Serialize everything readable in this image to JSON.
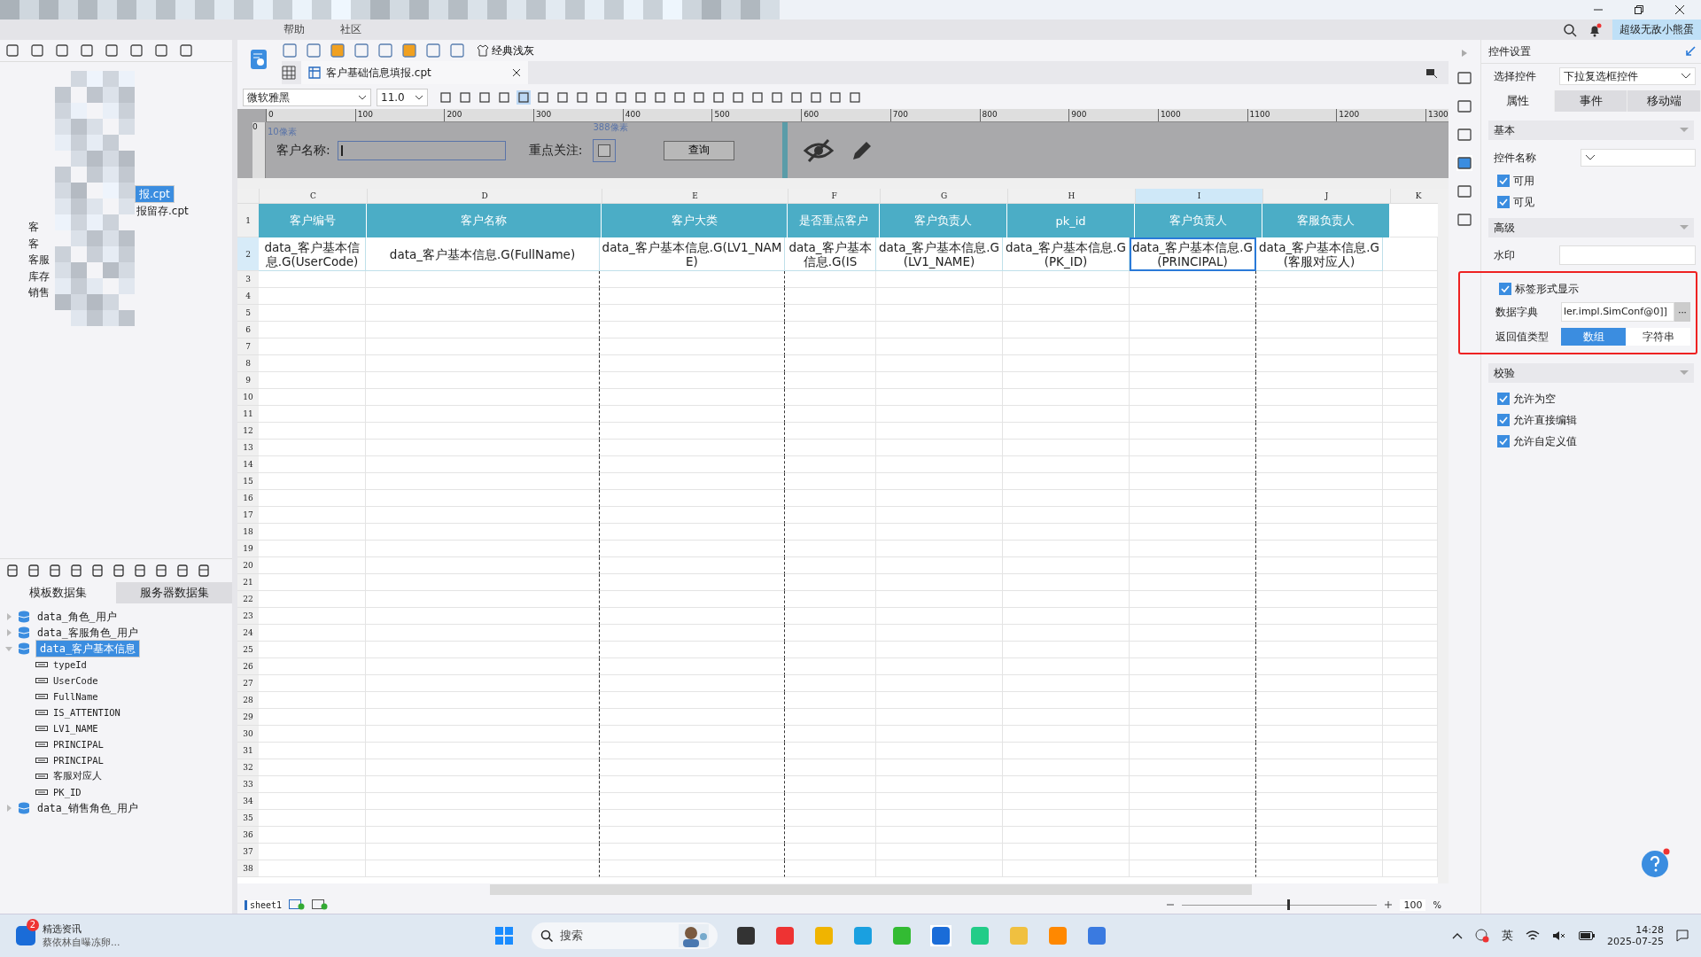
{
  "menu": [
    {
      "label": "帮助"
    },
    {
      "label": "社区"
    }
  ],
  "user": "超级无敌小熊蛋",
  "file_tree": [
    {
      "label": "报.cpt",
      "selected": true
    },
    {
      "label": "报留存.cpt",
      "selected": false
    },
    {
      "label": "客",
      "selected": false
    },
    {
      "label": "客",
      "selected": false
    },
    {
      "label": "客服",
      "selected": false
    },
    {
      "label": "库存",
      "selected": false
    },
    {
      "label": "销售",
      "selected": false
    }
  ],
  "dataset_tabs": [
    {
      "label": "模板数据集",
      "selected": true
    },
    {
      "label": "服务器数据集",
      "selected": false
    }
  ],
  "datasets": [
    {
      "label": "data_角色_用户",
      "expanded": false,
      "selected": false
    },
    {
      "label": "data_客服角色_用户",
      "expanded": false,
      "selected": false
    },
    {
      "label": "data_客户基本信息",
      "expanded": true,
      "selected": true,
      "children": [
        "typeId",
        "UserCode",
        "FullName",
        "IS_ATTENTION",
        "LV1_NAME",
        "PRINCIPAL",
        "PRINCIPAL",
        "客服对应人",
        "PK_ID"
      ]
    },
    {
      "label": "data_销售角色_用户",
      "expanded": false,
      "selected": false
    }
  ],
  "toolbar": {
    "theme_button": "经典浅灰",
    "file_tab": "客户基础信息填报.cpt",
    "font": "微软雅黑",
    "font_size": "11.0"
  },
  "ruler": [
    "0",
    "100",
    "200",
    "300",
    "400",
    "500",
    "600",
    "700",
    "800",
    "900",
    "1000",
    "1100",
    "1200",
    "1300"
  ],
  "vertical_ruler": "0",
  "parameter_panel": {
    "focus_checked": false,
    "name_label": "客户名称:",
    "focus_label": "重点关注:",
    "query_button": "查询",
    "marker_left": "10像素",
    "marker_right": "388像素"
  },
  "grid": {
    "columns": [
      {
        "letter": "C",
        "selected": false
      },
      {
        "letter": "D",
        "selected": false
      },
      {
        "letter": "E",
        "selected": false
      },
      {
        "letter": "F",
        "selected": false
      },
      {
        "letter": "G",
        "selected": false
      },
      {
        "letter": "H",
        "selected": false
      },
      {
        "letter": "I",
        "selected": true
      },
      {
        "letter": "J",
        "selected": false
      },
      {
        "letter": "K",
        "selected": false
      }
    ],
    "header_row": {
      "number": "1",
      "cells": [
        "客户编号",
        "客户名称",
        "客户大类",
        "是否重点客户",
        "客户负责人",
        "pk_id",
        "客户负责人",
        "客服负责人"
      ]
    },
    "data_row": {
      "number": "2",
      "cells": [
        {
          "text": "data_客户基本信息.G(UserCode)",
          "selected": false
        },
        {
          "text": "data_客户基本信息.G(FullName)",
          "selected": false
        },
        {
          "text": "data_客户基本信息.G(LV1_NAME)",
          "selected": false
        },
        {
          "text": "data_客户基本信息.G(IS",
          "selected": false
        },
        {
          "text": "data_客户基本信息.G(LV1_NAME)",
          "selected": false
        },
        {
          "text": "data_客户基本信息.G(PK_ID)",
          "selected": false
        },
        {
          "text": "data_客户基本信息.G(PRINCIPAL)",
          "selected": true
        },
        {
          "text": "data_客户基本信息.G(客服对应人)",
          "selected": false
        }
      ]
    },
    "empty_rows": [
      "3",
      "4",
      "5",
      "6",
      "7",
      "8",
      "9",
      "10",
      "11",
      "12",
      "13",
      "14",
      "15",
      "16",
      "17",
      "18",
      "19",
      "20",
      "21",
      "22",
      "23",
      "24",
      "25",
      "26",
      "27",
      "28",
      "29",
      "30",
      "31",
      "32",
      "33",
      "34",
      "35",
      "36",
      "37",
      "38"
    ]
  },
  "sheet_bar": {
    "sheet_tab": "sheet1",
    "zoom_slider": {
      "level": 0.54
    },
    "zoom": "100",
    "zoom_unit": "%"
  },
  "widget_settings": {
    "title": "控件设置",
    "select_label": "选择控件",
    "select_value": "下拉复选框控件",
    "tabs": [
      {
        "label": "属性",
        "selected": true
      },
      {
        "label": "事件",
        "selected": false
      },
      {
        "label": "移动端",
        "selected": false
      }
    ],
    "basic_section": "基本",
    "name_label": "控件名称",
    "basic_checks": [
      {
        "label": "可用",
        "checked": true
      },
      {
        "label": "可见",
        "checked": true
      }
    ],
    "advanced_section": "高级",
    "watermark_label": "水印",
    "label_display": {
      "label": "标签形式显示",
      "checked": true
    },
    "dictionary_label": "数据字典",
    "dictionary_value": "ler.impl.SimConf@0]]",
    "dictionary_button": "···",
    "return_label": "返回值类型",
    "return_options": [
      {
        "label": "数组",
        "selected": true
      },
      {
        "label": "字符串",
        "selected": false
      }
    ],
    "validation_section": "校验",
    "validation_checks": [
      {
        "label": "允许为空",
        "checked": true
      },
      {
        "label": "允许直接编辑",
        "checked": true
      },
      {
        "label": "允许自定义值",
        "checked": true
      }
    ]
  },
  "taskbar": {
    "news_badge": "2",
    "news_title": "精选资讯",
    "news_text": "蔡依林自曝冻卵...",
    "search": "搜索",
    "language": "英",
    "time": "14:28",
    "date": "2025-07-25"
  }
}
